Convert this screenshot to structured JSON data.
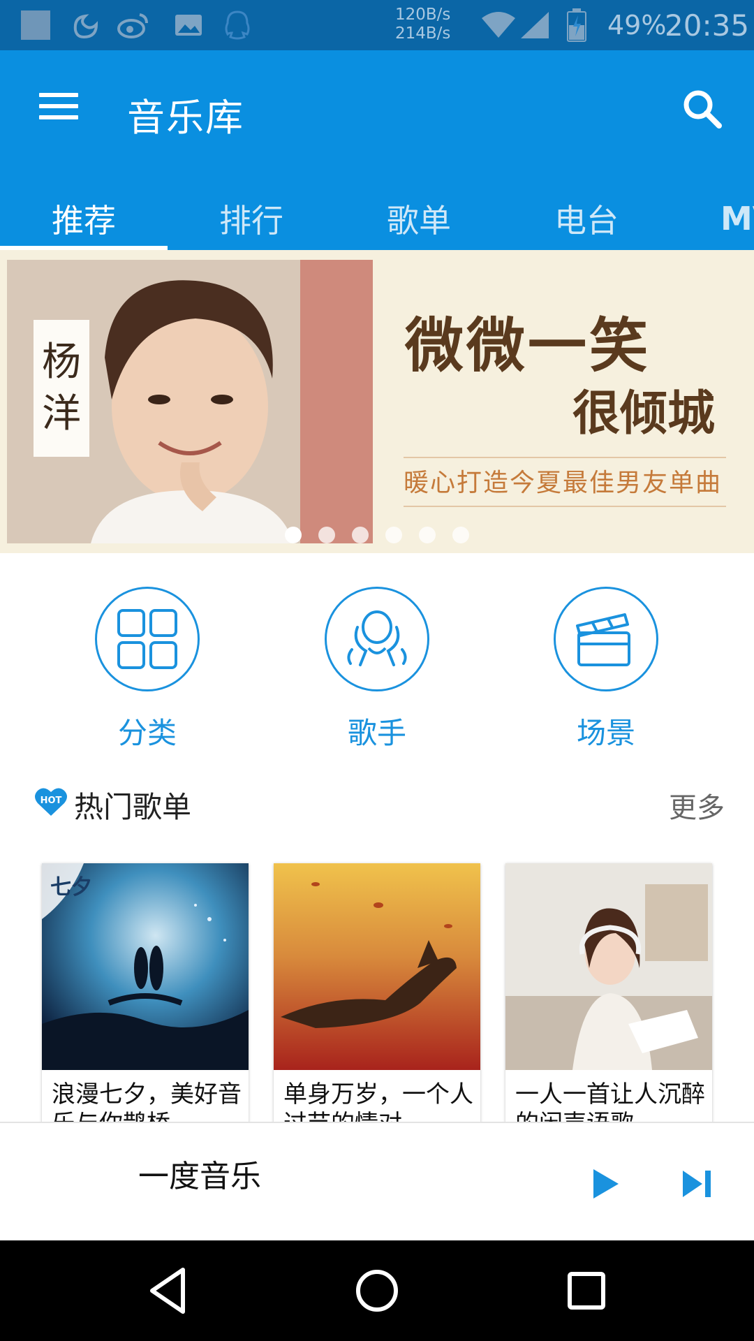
{
  "status_bar": {
    "net_up": "120B/s",
    "net_down": "214B/s",
    "battery": "49%",
    "time": "20:35",
    "icons": [
      "gallery-icon",
      "uc-browser-icon",
      "weibo-icon",
      "image-icon",
      "qq-icon",
      "wifi-icon",
      "signal-icon",
      "battery-icon"
    ]
  },
  "app_bar": {
    "title": "音乐库",
    "menu_icon": "hamburger-menu-icon",
    "search_icon": "search-icon",
    "background_color": "#0a8fe0"
  },
  "tabs": [
    {
      "label": "推荐",
      "active": true
    },
    {
      "label": "排行",
      "active": false
    },
    {
      "label": "歌单",
      "active": false
    },
    {
      "label": "电台",
      "active": false
    },
    {
      "label": "MV",
      "active": false
    }
  ],
  "banner": {
    "name_tag": [
      "杨",
      "洋"
    ],
    "title_line1": "微微一笑",
    "title_line2": "很倾城",
    "subtitle": "暖心打造今夏最佳男友单曲",
    "slide_count": 6,
    "active_slide": 1
  },
  "quick_entries": [
    {
      "label": "分类",
      "icon": "grid-icon"
    },
    {
      "label": "歌手",
      "icon": "singer-icon"
    },
    {
      "label": "场景",
      "icon": "clapperboard-icon"
    }
  ],
  "hot_playlists": {
    "badge": "HOT",
    "title": "热门歌单",
    "more": "更多",
    "items": [
      {
        "title": "浪漫七夕，美好音乐与你鹊桥",
        "cover_badge": "七夕"
      },
      {
        "title": "单身万岁，一个人过节的情对",
        "cover_badge": ""
      },
      {
        "title": "一人一首让人沉醉的闲声语歌",
        "cover_badge": ""
      }
    ]
  },
  "now_playing": {
    "title": "一度音乐",
    "play_icon": "play-icon",
    "next_icon": "skip-next-icon"
  },
  "nav_bar": {
    "icons": [
      "back-icon",
      "home-icon",
      "recents-icon"
    ]
  },
  "colors": {
    "accent": "#1a92de",
    "status_bar": "#0b66a6"
  }
}
